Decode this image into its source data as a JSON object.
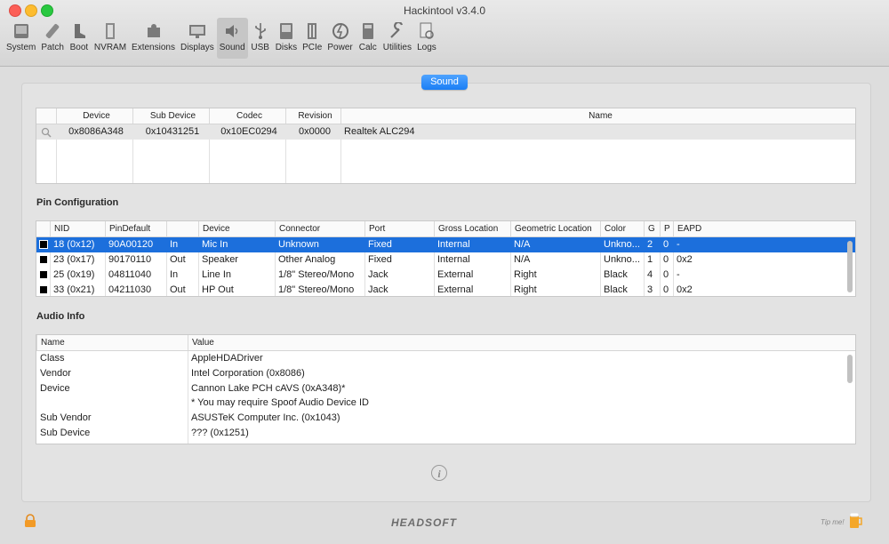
{
  "window": {
    "title": "Hackintool v3.4.0"
  },
  "toolbar": {
    "items": [
      {
        "label": "System",
        "icon": "system-icon"
      },
      {
        "label": "Patch",
        "icon": "patch-icon"
      },
      {
        "label": "Boot",
        "icon": "boot-icon"
      },
      {
        "label": "NVRAM",
        "icon": "nvram-icon"
      },
      {
        "label": "Extensions",
        "icon": "extensions-icon"
      },
      {
        "label": "Displays",
        "icon": "displays-icon"
      },
      {
        "label": "Sound",
        "icon": "sound-icon"
      },
      {
        "label": "USB",
        "icon": "usb-icon"
      },
      {
        "label": "Disks",
        "icon": "disks-icon"
      },
      {
        "label": "PCIe",
        "icon": "pcie-icon"
      },
      {
        "label": "Power",
        "icon": "power-icon"
      },
      {
        "label": "Calc",
        "icon": "calc-icon"
      },
      {
        "label": "Utilities",
        "icon": "utilities-icon"
      },
      {
        "label": "Logs",
        "icon": "logs-icon"
      }
    ],
    "active": "Sound"
  },
  "segment": {
    "label": "Sound"
  },
  "devices": {
    "headers": [
      "Device",
      "Sub Device",
      "Codec",
      "Revision",
      "Name"
    ],
    "rows": [
      [
        "0x8086A348",
        "0x10431251",
        "0x10EC0294",
        "0x0000",
        "Realtek ALC294"
      ]
    ]
  },
  "pin_config": {
    "title": "Pin Configuration",
    "headers": [
      "NID",
      "PinDefault",
      "",
      "Device",
      "Connector",
      "Port",
      "Gross Location",
      "Geometric Location",
      "Color",
      "G",
      "P",
      "EAPD"
    ],
    "rows": [
      [
        "18 (0x12)",
        "90A00120",
        "In",
        "Mic In",
        "Unknown",
        "Fixed",
        "Internal",
        "N/A",
        "Unkno...",
        "2",
        "0",
        "-"
      ],
      [
        "23 (0x17)",
        "90170110",
        "Out",
        "Speaker",
        "Other Analog",
        "Fixed",
        "Internal",
        "N/A",
        "Unkno...",
        "1",
        "0",
        "0x2"
      ],
      [
        "25 (0x19)",
        "04811040",
        "In",
        "Line In",
        "1/8\" Stereo/Mono",
        "Jack",
        "External",
        "Right",
        "Black",
        "4",
        "0",
        "-"
      ],
      [
        "33 (0x21)",
        "04211030",
        "Out",
        "HP Out",
        "1/8\" Stereo/Mono",
        "Jack",
        "External",
        "Right",
        "Black",
        "3",
        "0",
        "0x2"
      ]
    ],
    "selected_index": 0
  },
  "audio_info": {
    "title": "Audio Info",
    "headers": [
      "Name",
      "Value"
    ],
    "rows": [
      [
        "Class",
        "AppleHDADriver"
      ],
      [
        "Vendor",
        "Intel Corporation (0x8086)"
      ],
      [
        "Device",
        "Cannon Lake PCH cAVS (0xA348)*"
      ],
      [
        "",
        "* You may require Spoof Audio Device ID"
      ],
      [
        "Sub Vendor",
        "ASUSTeK Computer Inc. (0x1043)"
      ],
      [
        "Sub Device",
        "??? (0x1251)"
      ]
    ]
  },
  "footer": {
    "brand": "HEADSOFT",
    "tip": "Tip me!",
    "info": "i"
  }
}
